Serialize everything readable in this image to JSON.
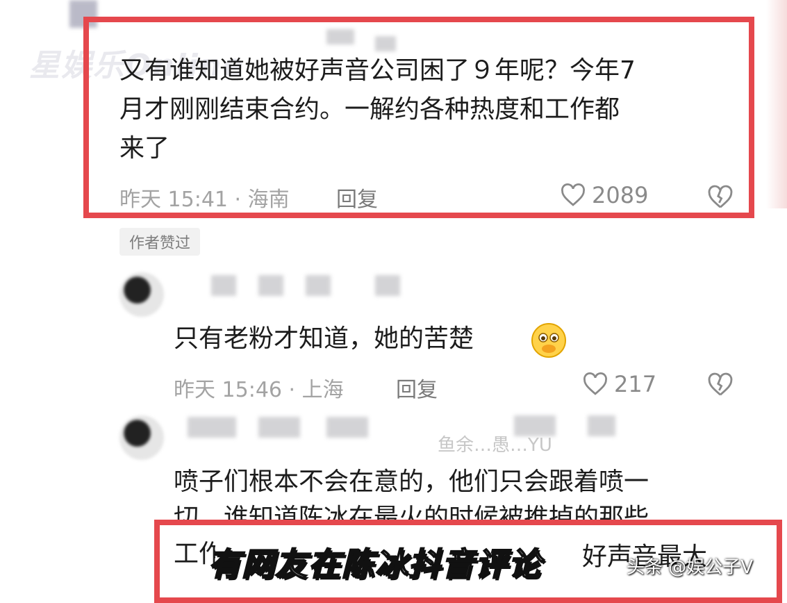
{
  "watermark": "星娱乐Online",
  "comments": [
    {
      "text_lines": [
        "又有谁知道她被好声音公司困了９年呢？今年7",
        "月才刚刚结束合约。一解约各种热度和工作都",
        "来了"
      ],
      "meta": "昨天 15:41 · 海南",
      "reply": "回复",
      "likes": "2089"
    },
    {
      "text": "只有老粉才知道，她的苦楚",
      "meta": "昨天 15:46 · 上海",
      "reply": "回复",
      "likes": "217"
    },
    {
      "text_lines": [
        "喷子们根本不会在意的，他们只会跟着喷一",
        "切。谁知道陈冰在最火的时候被推掉的那些",
        "工作"
      ],
      "faint_username": "鱼余…愚…YU"
    }
  ],
  "author_badge": "作者赞过",
  "bottom_line_fragment": "好声音最大",
  "caption": "有网友在陈冰抖音评论",
  "source": "头条 @娱公子V",
  "colors": {
    "highlight": "#e5484d"
  },
  "icons": [
    "heart-icon",
    "broken-heart-icon",
    "emoji-icon"
  ]
}
